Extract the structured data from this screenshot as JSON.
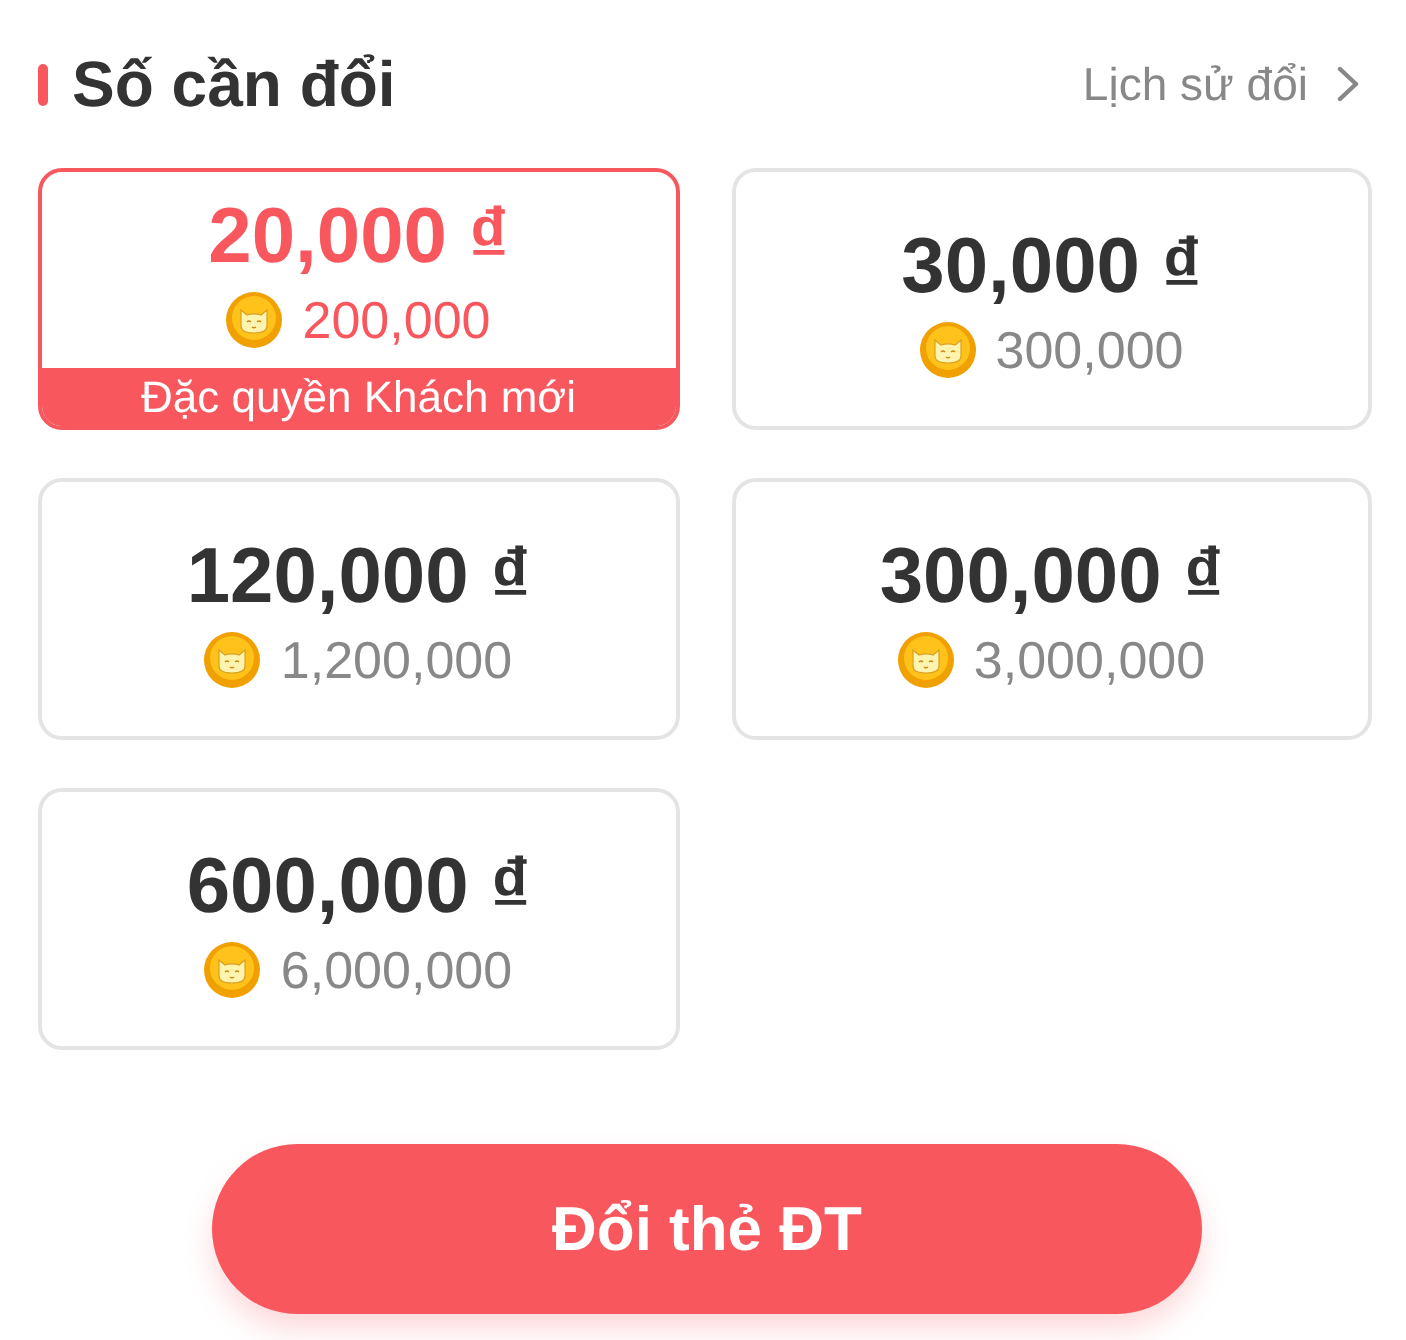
{
  "header": {
    "title": "Số cần đổi",
    "history_link": "Lịch sử đổi"
  },
  "options": [
    {
      "amount": "20,000 ₫",
      "coins": "200,000",
      "selected": true,
      "badge": "Đặc quyền Khách mới"
    },
    {
      "amount": "30,000 ₫",
      "coins": "300,000",
      "selected": false
    },
    {
      "amount": "120,000 ₫",
      "coins": "1,200,000",
      "selected": false
    },
    {
      "amount": "300,000 ₫",
      "coins": "3,000,000",
      "selected": false
    },
    {
      "amount": "600,000 ₫",
      "coins": "6,000,000",
      "selected": false
    }
  ],
  "button": "Đổi thẻ ĐT"
}
